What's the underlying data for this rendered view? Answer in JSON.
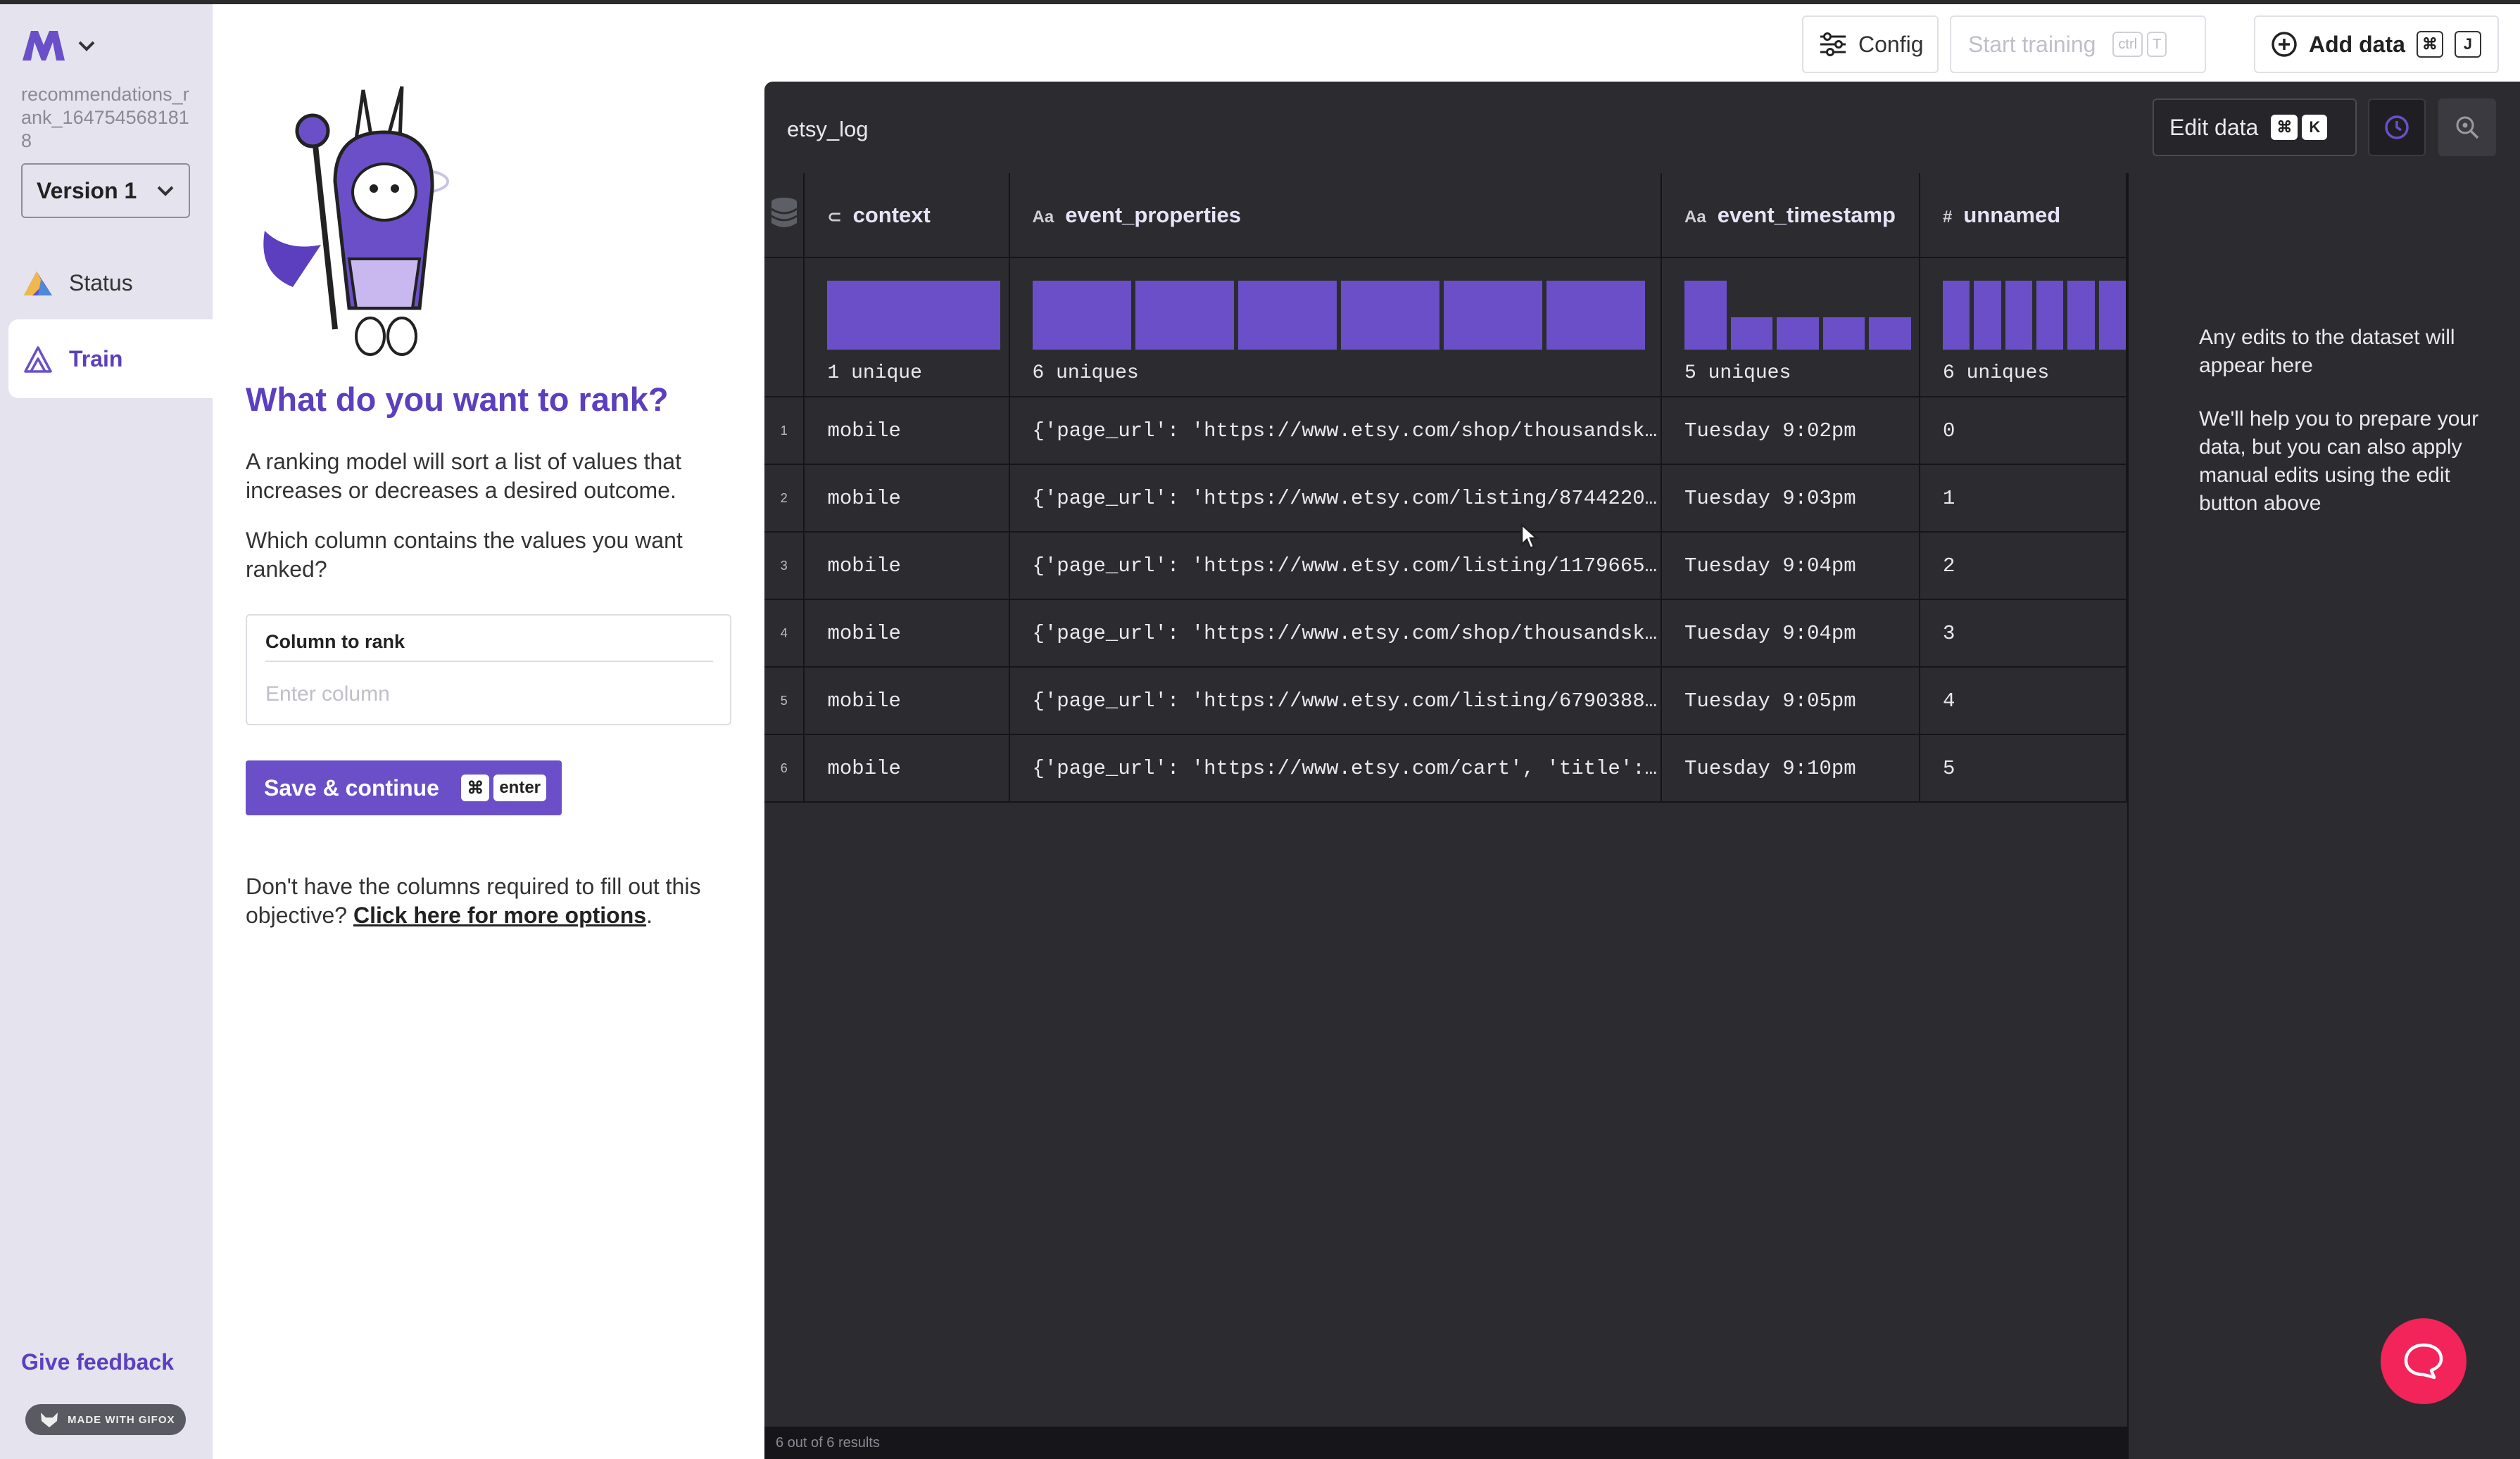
{
  "sidebar": {
    "project_name": "recommendations_rank_1647545681818",
    "version": "Version 1",
    "nav": [
      {
        "label": "Status",
        "icon": "triangle-mountain-icon"
      },
      {
        "label": "Train",
        "icon": "flask-icon"
      }
    ],
    "give_feedback": "Give feedback",
    "gifox_badge": "MADE WITH GIFOX"
  },
  "panel": {
    "title": "What do you want to rank?",
    "description": "A ranking model will sort a list of values that increases or decreases a desired outcome.",
    "question": "Which column contains the values you want ranked?",
    "column_label": "Column to rank",
    "column_placeholder": "Enter column",
    "column_value": "",
    "save_label": "Save & continue",
    "save_shortcut": [
      "⌘",
      "enter"
    ],
    "footer_text": "Don't have the columns required to fill out this objective? ",
    "footer_link": "Click here for more options",
    "footer_end": "."
  },
  "topbar": {
    "config_label": "Config",
    "start_label": "Start training",
    "start_shortcut": [
      "ctrl",
      "T"
    ],
    "add_label": "Add data",
    "add_shortcut": [
      "⌘",
      "J"
    ]
  },
  "dataset": {
    "name": "etsy_log",
    "edit_label": "Edit data",
    "edit_shortcut": [
      "⌘",
      "K"
    ],
    "columns": [
      {
        "name": "context",
        "type_icon": "tag-icon",
        "type_text": "",
        "uniques": "1 unique",
        "hist": [
          1.0
        ]
      },
      {
        "name": "event_properties",
        "type_icon": "text-type-icon",
        "type_text": "Aa",
        "uniques": "6 uniques",
        "hist": [
          1,
          1,
          1,
          1,
          1,
          1
        ]
      },
      {
        "name": "event_timestamp",
        "type_icon": "text-type-icon",
        "type_text": "Aa",
        "uniques": "5 uniques",
        "hist": [
          1.0,
          0.47,
          0.47,
          0.47,
          0.47
        ]
      },
      {
        "name": "unnamed",
        "type_icon": "number-type-icon",
        "type_text": "#",
        "uniques": "6 uniques",
        "hist": [
          1,
          1,
          1,
          1,
          1,
          1
        ]
      }
    ],
    "rows": [
      {
        "idx": "1",
        "context": "mobile",
        "event_properties": "{'page_url': 'https://www.etsy.com/shop/thousandsk…",
        "event_timestamp": "Tuesday 9:02pm",
        "unnamed": "0"
      },
      {
        "idx": "2",
        "context": "mobile",
        "event_properties": "{'page_url': 'https://www.etsy.com/listing/8744220…",
        "event_timestamp": "Tuesday 9:03pm",
        "unnamed": "1"
      },
      {
        "idx": "3",
        "context": "mobile",
        "event_properties": "{'page_url': 'https://www.etsy.com/listing/1179665…",
        "event_timestamp": "Tuesday 9:04pm",
        "unnamed": "2"
      },
      {
        "idx": "4",
        "context": "mobile",
        "event_properties": "{'page_url': 'https://www.etsy.com/shop/thousandsk…",
        "event_timestamp": "Tuesday 9:04pm",
        "unnamed": "3"
      },
      {
        "idx": "5",
        "context": "mobile",
        "event_properties": "{'page_url': 'https://www.etsy.com/listing/6790388…",
        "event_timestamp": "Tuesday 9:05pm",
        "unnamed": "4"
      },
      {
        "idx": "6",
        "context": "mobile",
        "event_properties": "{'page_url': 'https://www.etsy.com/cart', 'title':…",
        "event_timestamp": "Tuesday 9:10pm",
        "unnamed": "5"
      }
    ],
    "results_text": "6 out of 6 results",
    "note_1": "Any edits to the dataset will appear here",
    "note_2": "We'll help you to prepare your data, but you can also apply manual edits using the edit button above"
  },
  "colors": {
    "accent": "#5b3fbf",
    "bar": "#6a4fc9",
    "panel_bg": "#2c2c30",
    "sidebar_bg": "#e4e3ee",
    "chat": "#f2245a"
  }
}
